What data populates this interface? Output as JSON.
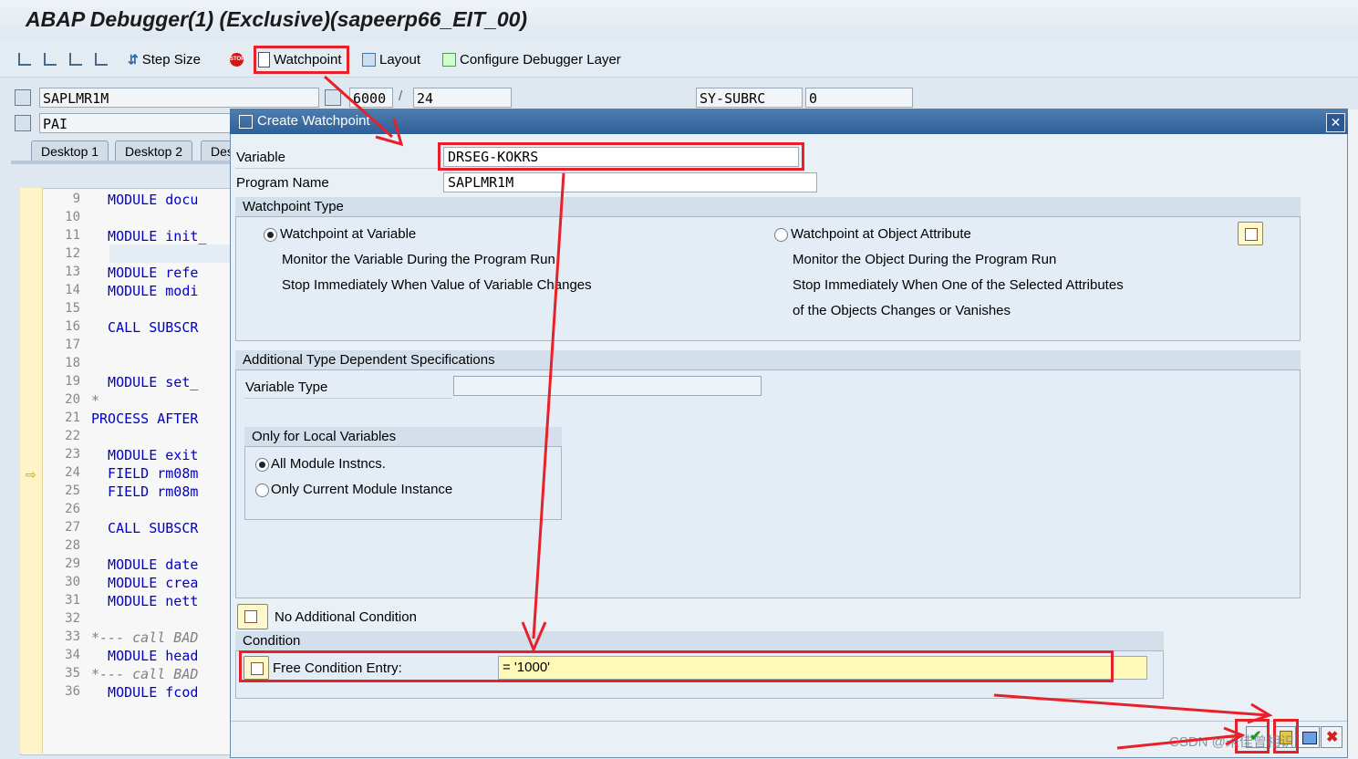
{
  "window": {
    "title": "ABAP Debugger(1)  (Exclusive)(sapeerp66_EIT_00)"
  },
  "toolbar": {
    "step_size_label": "Step Size",
    "watchpoint_label": "Watchpoint",
    "layout_label": "Layout",
    "configure_label": "Configure Debugger Layer"
  },
  "info": {
    "program": "SAPLMR1M",
    "event": "PAI",
    "screen": "6000",
    "separator": "/",
    "line": "24",
    "sy_field": "SY-SUBRC",
    "sy_value": "0"
  },
  "tabs": [
    "Desktop 1",
    "Desktop 2",
    "Des"
  ],
  "code": {
    "lines": [
      {
        "no": "9",
        "text": "  MODULE docu",
        "cmt": false
      },
      {
        "no": "10",
        "text": "",
        "cmt": false
      },
      {
        "no": "11",
        "text": "  MODULE init_",
        "cmt": false
      },
      {
        "no": "12",
        "text": "",
        "cmt": false
      },
      {
        "no": "13",
        "text": "  MODULE refe",
        "cmt": false
      },
      {
        "no": "14",
        "text": "  MODULE modi",
        "cmt": false
      },
      {
        "no": "15",
        "text": "",
        "cmt": false
      },
      {
        "no": "16",
        "text": "  CALL SUBSCR",
        "cmt": false
      },
      {
        "no": "17",
        "text": "",
        "cmt": false
      },
      {
        "no": "18",
        "text": "",
        "cmt": false
      },
      {
        "no": "19",
        "text": "  MODULE set_",
        "cmt": false
      },
      {
        "no": "20",
        "text": "*",
        "cmt": true
      },
      {
        "no": "21",
        "text": "PROCESS AFTER",
        "cmt": false
      },
      {
        "no": "22",
        "text": "",
        "cmt": false
      },
      {
        "no": "23",
        "text": "  MODULE exit",
        "cmt": false
      },
      {
        "no": "24",
        "text": "  FIELD rm08m",
        "cmt": false
      },
      {
        "no": "25",
        "text": "  FIELD rm08m",
        "cmt": false
      },
      {
        "no": "26",
        "text": "",
        "cmt": false
      },
      {
        "no": "27",
        "text": "  CALL SUBSCR",
        "cmt": false
      },
      {
        "no": "28",
        "text": "",
        "cmt": false
      },
      {
        "no": "29",
        "text": "  MODULE date",
        "cmt": false
      },
      {
        "no": "30",
        "text": "  MODULE crea",
        "cmt": false
      },
      {
        "no": "31",
        "text": "  MODULE nett",
        "cmt": false
      },
      {
        "no": "32",
        "text": "",
        "cmt": false
      },
      {
        "no": "33",
        "text": "*--- call BAD",
        "cmt": true
      },
      {
        "no": "34",
        "text": "  MODULE head",
        "cmt": false
      },
      {
        "no": "35",
        "text": "*--- call BAD",
        "cmt": true
      },
      {
        "no": "36",
        "text": "  MODULE fcod",
        "cmt": false
      }
    ],
    "current_marker": "⇨"
  },
  "dialog": {
    "title": "Create Watchpoint",
    "close": "✕",
    "variable_label": "Variable",
    "variable_value": "DRSEG-KOKRS",
    "program_label": "Program Name",
    "program_value": "SAPLMR1M",
    "wp_type": {
      "header": "Watchpoint Type",
      "var_option": "Watchpoint at Variable",
      "var_desc1": "Monitor the Variable During the Program Run",
      "var_desc2": "Stop Immediately When Value of Variable Changes",
      "obj_option": "Watchpoint at Object Attribute",
      "obj_desc1": "Monitor the Object During the Program Run",
      "obj_desc2": "Stop Immediately When One of the Selected Attributes",
      "obj_desc3": "of the Objects Changes or Vanishes"
    },
    "additional": {
      "header": "Additional Type Dependent Specifications",
      "var_type_label": "Variable Type",
      "var_type_value": "",
      "local_header": "Only for Local Variables",
      "all_modules": "All Module Instncs.",
      "current_module": "Only Current Module Instance"
    },
    "no_condition_label": "No Additional Condition",
    "condition": {
      "header": "Condition",
      "free_label": "Free Condition Entry:",
      "free_value": "= '1000'"
    }
  },
  "watermark": "CSDN @未佳曾相识"
}
